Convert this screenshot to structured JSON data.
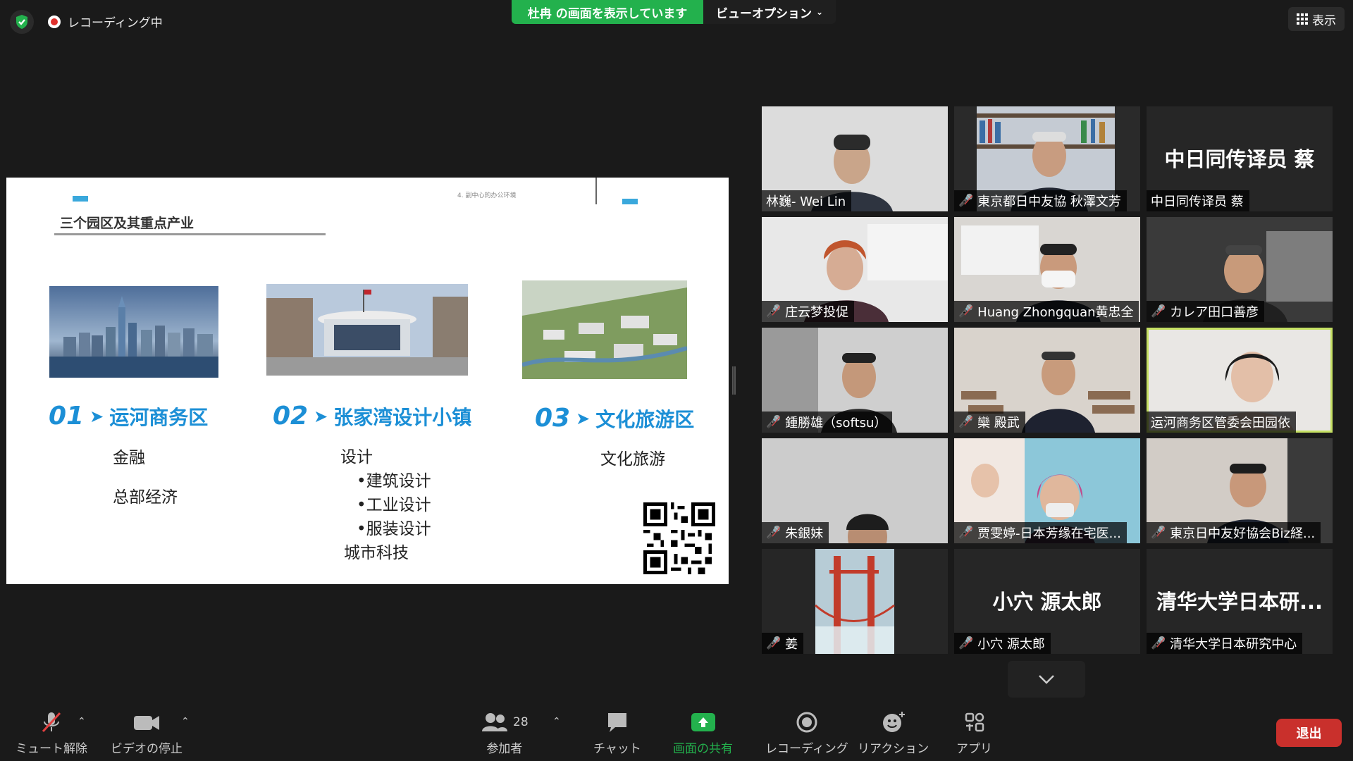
{
  "topbar": {
    "recording_label": "レコーディング中",
    "share_banner": "杜冉 の画面を表示しています",
    "view_options": "ビューオプション",
    "view_button": "表示"
  },
  "slide": {
    "header_caption": "4. 副中心的办公环境",
    "title": "三个园区及其重点产业",
    "zones": [
      {
        "num": "01",
        "name": "运河商务区",
        "lines": [
          "金融",
          "总部经济"
        ]
      },
      {
        "num": "02",
        "name": "张家湾设计小镇",
        "lines": [
          "设计",
          "•建筑设计",
          "•工业设计",
          "•服装设计",
          "城市科技"
        ]
      },
      {
        "num": "03",
        "name": "文化旅游区",
        "lines": [
          "文化旅游"
        ]
      }
    ]
  },
  "gallery": [
    {
      "name": "林巍- Wei Lin",
      "muted": false
    },
    {
      "name": "東京都日中友協 秋澤文芳",
      "muted": true
    },
    {
      "name": "中日同传译员 蔡",
      "muted": false,
      "display": "中日同传译员 蔡"
    },
    {
      "name": "庄云梦投促",
      "muted": true
    },
    {
      "name": "Huang Zhongquan黄忠全",
      "muted": true
    },
    {
      "name": "カレア田口善彦",
      "muted": true
    },
    {
      "name": "鍾勝雄（softsu）",
      "muted": true
    },
    {
      "name": "欒 殿武",
      "muted": true
    },
    {
      "name": "运河商务区管委会田园依",
      "muted": false,
      "speaking": true
    },
    {
      "name": "朱銀妹",
      "muted": true
    },
    {
      "name": "贾雯婷-日本芳缘在宅医...",
      "muted": true
    },
    {
      "name": "東京日中友好協会Biz経...",
      "muted": true
    },
    {
      "name": "姜",
      "muted": true
    },
    {
      "name": "小穴 源太郎",
      "muted": true,
      "display": "小穴 源太郎"
    },
    {
      "name": "清华大学日本研究中心",
      "muted": true,
      "display": "清华大学日本研..."
    }
  ],
  "toolbar": {
    "unmute": "ミュート解除",
    "stop_video": "ビデオの停止",
    "participants": "参加者",
    "participants_count": "28",
    "chat": "チャット",
    "share_screen": "画面の共有",
    "record": "レコーディング",
    "reactions": "リアクション",
    "apps": "アプリ",
    "leave": "退出"
  },
  "colors": {
    "share_green": "#23b14d",
    "speaker_outline": "#c5e063",
    "leave_red": "#c9302c",
    "slide_blue": "#1c8fd6"
  }
}
